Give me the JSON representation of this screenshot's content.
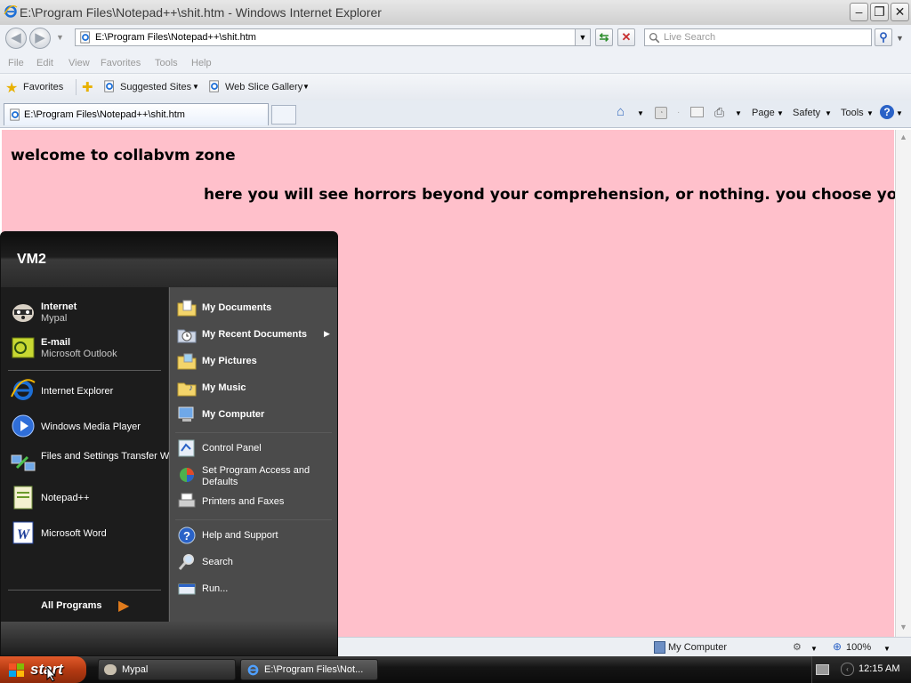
{
  "window": {
    "title": "E:\\Program Files\\Notepad++\\shit.htm - Windows Internet Explorer",
    "address": "E:\\Program Files\\Notepad++\\shit.htm",
    "search_placeholder": "Live Search"
  },
  "menu": [
    "File",
    "Edit",
    "View",
    "Favorites",
    "Tools",
    "Help"
  ],
  "favorites_bar": {
    "favorites_label": "Favorites",
    "suggested_sites": "Suggested Sites",
    "web_slice_gallery": "Web Slice Gallery"
  },
  "tab": {
    "title": "E:\\Program Files\\Notepad++\\shit.htm"
  },
  "command_bar": {
    "page": "Page",
    "safety": "Safety",
    "tools": "Tools"
  },
  "page": {
    "heading": "welcome to collabvm zone",
    "subheading": "here you will see horrors beyond your comprehension, or nothing. you choose your fate",
    "background": "#ffc0cb"
  },
  "status_bar": {
    "zone": "My Computer",
    "zoom": "100%"
  },
  "start_menu": {
    "user": "VM2",
    "pinned": [
      {
        "title": "Internet",
        "subtitle": "Mypal",
        "icon": "raccoon-browser-icon"
      },
      {
        "title": "E-mail",
        "subtitle": "Microsoft Outlook",
        "icon": "outlook-icon"
      }
    ],
    "recent": [
      {
        "title": "Internet Explorer",
        "icon": "ie-icon"
      },
      {
        "title": "Windows Media Player",
        "icon": "media-player-icon"
      },
      {
        "title": "Files and Settings Transfer Wizard",
        "icon": "transfer-wizard-icon"
      },
      {
        "title": "Notepad++",
        "icon": "notepadpp-icon"
      },
      {
        "title": "Microsoft Word",
        "icon": "word-icon"
      }
    ],
    "all_programs": "All Programs",
    "places": [
      {
        "title": "My Documents",
        "icon": "folder-documents-icon"
      },
      {
        "title": "My Recent Documents",
        "icon": "recent-documents-icon"
      },
      {
        "title": "My Pictures",
        "icon": "folder-pictures-icon"
      },
      {
        "title": "My Music",
        "icon": "folder-music-icon"
      },
      {
        "title": "My Computer",
        "icon": "computer-icon"
      }
    ],
    "system": [
      {
        "title": "Control Panel",
        "icon": "control-panel-icon"
      },
      {
        "title": "Set Program Access and Defaults",
        "icon": "program-defaults-icon"
      },
      {
        "title": "Printers and Faxes",
        "icon": "printer-icon"
      }
    ],
    "help": [
      {
        "title": "Help and Support",
        "icon": "help-icon"
      },
      {
        "title": "Search",
        "icon": "search-icon"
      },
      {
        "title": "Run...",
        "icon": "run-icon"
      }
    ]
  },
  "taskbar": {
    "start": "start",
    "items": [
      "Mypal",
      "E:\\Program Files\\Not..."
    ],
    "clock": "12:15 AM"
  }
}
